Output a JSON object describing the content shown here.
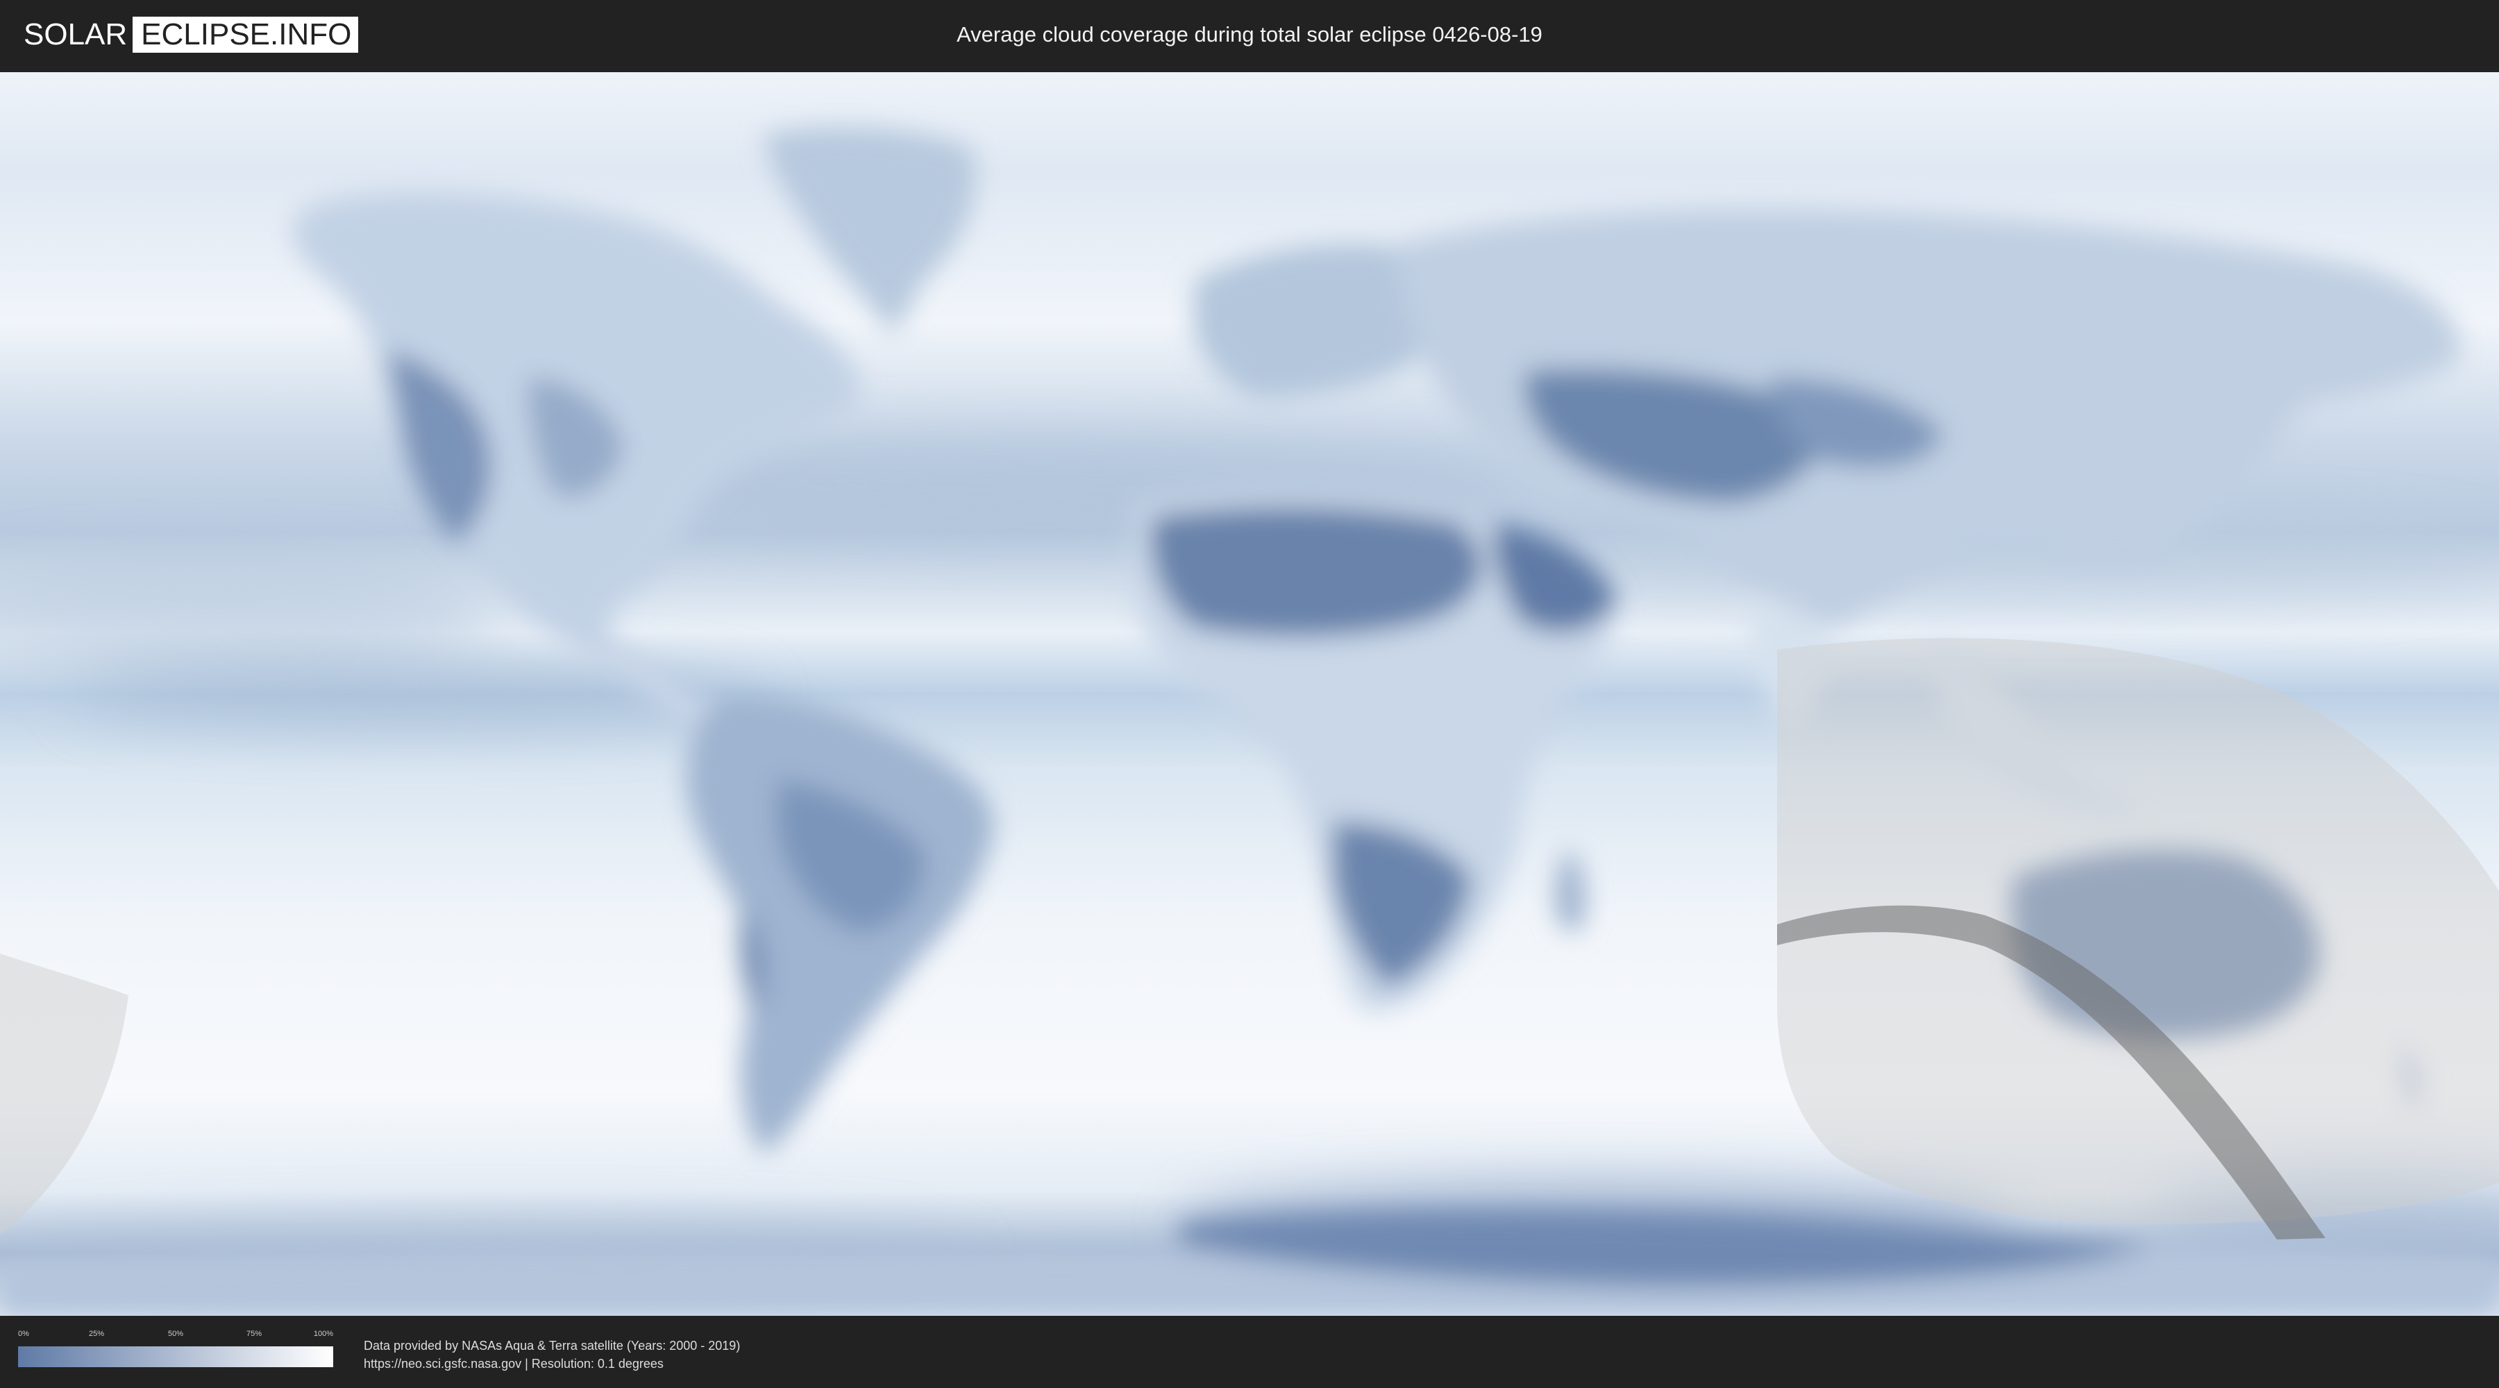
{
  "header": {
    "logo_left": "SOLAR",
    "logo_right": "ECLIPSE.INFO",
    "title": "Average cloud coverage during total solar eclipse 0426-08-19"
  },
  "legend": {
    "ticks": [
      "0%",
      "25%",
      "50%",
      "75%",
      "100%"
    ],
    "color_low": "#5f7aa6",
    "color_high": "#ffffff"
  },
  "footer": {
    "credit_line": "Data provided by NASAs Aqua & Terra satellite (Years: 2000 - 2019)",
    "source_line": "https://neo.sci.gsfc.nasa.gov | Resolution: 0.1 degrees"
  },
  "colors": {
    "background": "#222222",
    "clear_sky": "#5f7aa6",
    "cloudy": "#f4f8fc",
    "eclipse_zone": "#cfcfcf",
    "totality_path": "#6b6b6b"
  }
}
